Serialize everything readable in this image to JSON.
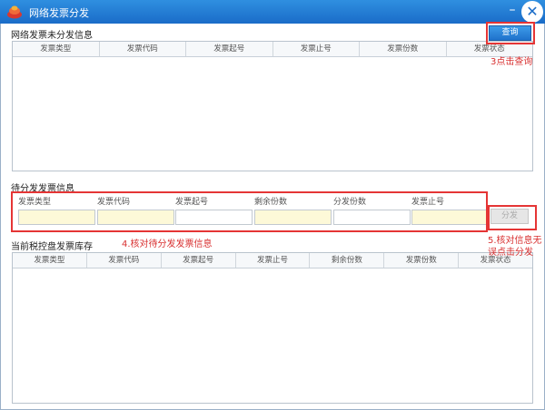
{
  "window": {
    "title": "网络发票分发",
    "minimize_glyph": "–",
    "close_glyph": "✕",
    "logo_icon": "tax-logo-icon",
    "accent": "#1a6cc8"
  },
  "undistributed": {
    "title": "网络发票未分发信息",
    "query_label": "查询",
    "columns": [
      "发票类型",
      "发票代码",
      "发票起号",
      "发票止号",
      "发票份数",
      "发票状态"
    ]
  },
  "pending": {
    "title": "待分发发票信息",
    "fields": [
      {
        "label": "发票类型",
        "value": "",
        "style": "readonly"
      },
      {
        "label": "发票代码",
        "value": "",
        "style": "readonly"
      },
      {
        "label": "发票起号",
        "value": "",
        "style": "editable"
      },
      {
        "label": "剩余份数",
        "value": "",
        "style": "readonly"
      },
      {
        "label": "分发份数",
        "value": "",
        "style": "editable"
      },
      {
        "label": "发票止号",
        "value": "",
        "style": "readonly"
      }
    ],
    "distribute_label": "分发"
  },
  "inventory": {
    "title": "当前税控盘发票库存",
    "columns": [
      "发票类型",
      "发票代码",
      "发票起号",
      "发票止号",
      "剩余份数",
      "发票份数",
      "发票状态"
    ]
  },
  "annotations": {
    "step3": "3点击查询",
    "step4": "4.核对待分发发票信息",
    "step5_line1": "5.核对信息无",
    "step5_line2": "误点击分发",
    "color": "#d83030"
  }
}
